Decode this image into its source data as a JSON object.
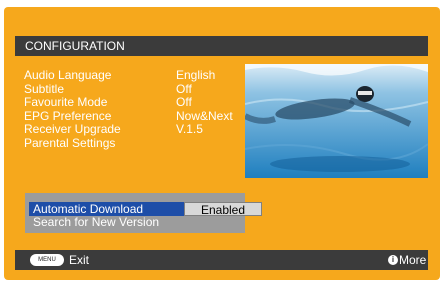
{
  "header": {
    "title": "CONFIGURATION"
  },
  "settings": {
    "labels": [
      "Audio Language",
      "Subtitle",
      "Favourite Mode",
      "EPG Preference",
      "Receiver Upgrade",
      "Parental Settings"
    ],
    "values": [
      "English",
      "Off",
      "Off",
      "Now&Next",
      "V.1.5"
    ]
  },
  "submenu": {
    "row1_label": "Automatic Download",
    "row1_value": "Enabled",
    "row2_label": "Search for New Version"
  },
  "footer": {
    "menu_key": "MENU",
    "exit_label": "Exit",
    "info_glyph": "i",
    "more_label": "More"
  },
  "colors": {
    "frame": "#f6a81c",
    "bar": "#3b3b3b",
    "highlight": "#1e4ea8"
  }
}
